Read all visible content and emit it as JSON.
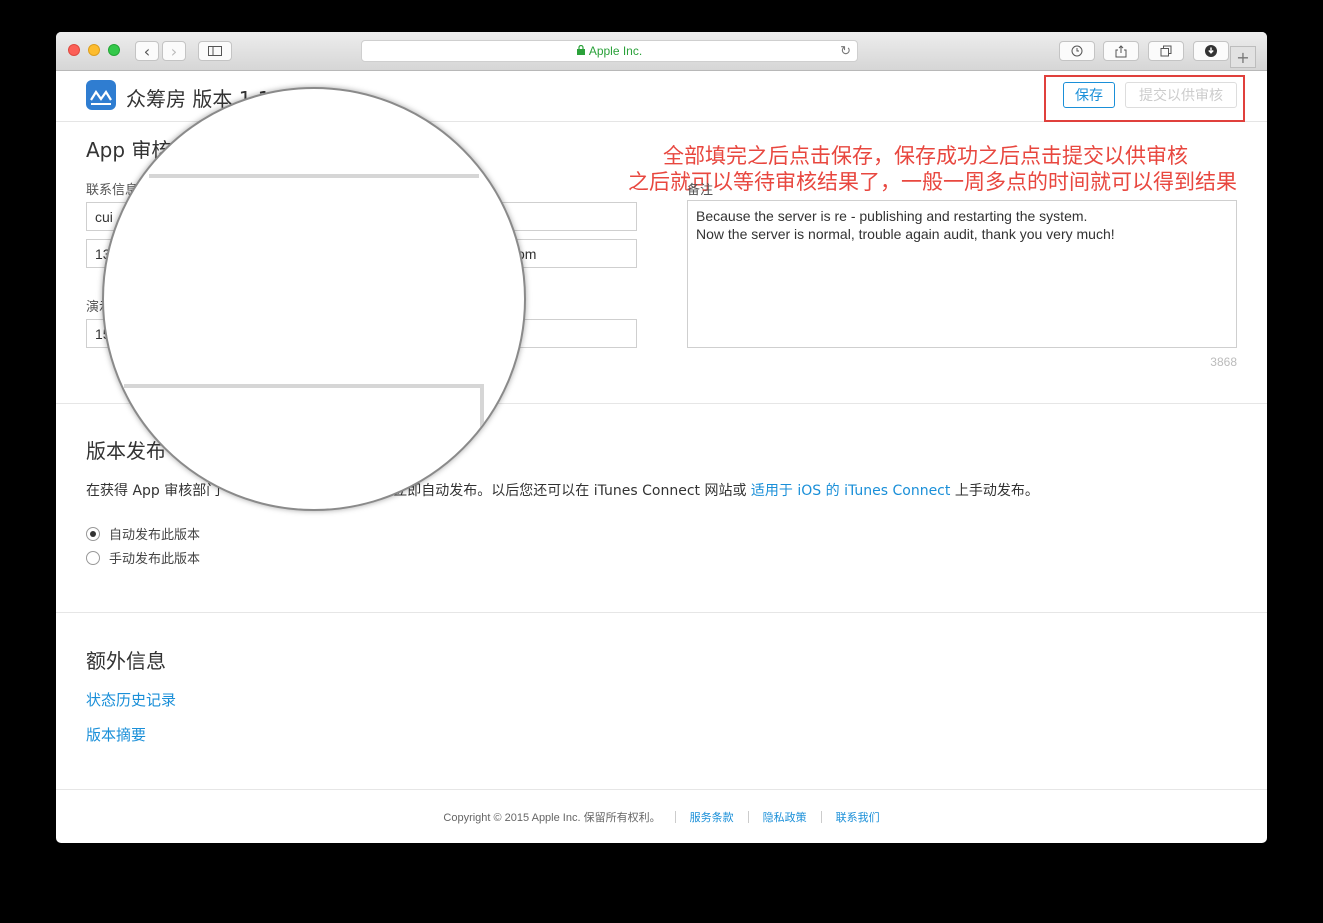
{
  "browser": {
    "url_text": "Apple Inc.",
    "back_glyph": "‹",
    "forward_glyph": "›",
    "new_tab_glyph": "+"
  },
  "header": {
    "app_title": "众筹房  版本 1.1.3",
    "save_label": "保存",
    "submit_label": "提交以供审核"
  },
  "annotation": {
    "line1": "全部填完之后点击保存，保存成功之后点击提交以供审核",
    "line2": "之后就可以等待审核结果了，一般一周多点的时间就可以得到结果",
    "color": "#e8473f"
  },
  "review_info": {
    "title": "App 审核信息",
    "contact_label": "联系信息",
    "contact_name_value": "cui",
    "contact_email_value": "om",
    "contact_phone_value": "13",
    "demo_label": "演示",
    "demo_value": "15",
    "notes_label": "备注",
    "notes_line1": "Because the server is re - publishing and restarting the system.",
    "notes_line2": "Now the server is normal, trouble again audit, thank you very much!",
    "char_count": "3868"
  },
  "release": {
    "title": "版本发布",
    "desc_prefix": "在获得 App 审核部门",
    "desc_mid": "可立即自动发布。以后您还可以在 iTunes Connect 网站或 ",
    "desc_link": "适用于 iOS 的 iTunes Connect",
    "desc_suffix": " 上手动发布。",
    "options": [
      {
        "label": "自动发布此版本",
        "checked": true
      },
      {
        "label": "手动发布此版本",
        "checked": false
      }
    ]
  },
  "extra": {
    "title": "额外信息",
    "links": [
      "状态历史记录",
      "版本摘要"
    ]
  },
  "footer": {
    "copyright": "Copyright © 2015 Apple Inc. 保留所有权利。",
    "links": [
      "服务条款",
      "隐私政策",
      "联系我们"
    ]
  },
  "colors": {
    "accent": "#1a8fd8",
    "annotation_red": "#e8473f",
    "url_green": "#2ba13a"
  }
}
